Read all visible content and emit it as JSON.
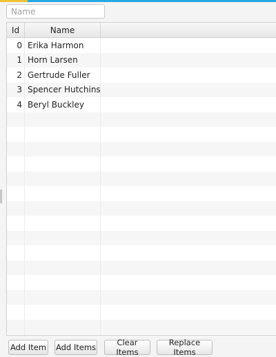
{
  "search": {
    "placeholder": "Name",
    "value": ""
  },
  "table": {
    "columns": [
      {
        "label": "Id"
      },
      {
        "label": "Name"
      }
    ],
    "rows": [
      {
        "id": "0",
        "name": "Erika Harmon"
      },
      {
        "id": "1",
        "name": "Horn Larsen"
      },
      {
        "id": "2",
        "name": "Gertrude Fuller"
      },
      {
        "id": "3",
        "name": "Spencer Hutchinson"
      },
      {
        "id": "4",
        "name": "Beryl Buckley"
      }
    ]
  },
  "toolbar": {
    "add_item_label": "Add Item",
    "add_items_label": "Add Items",
    "clear_items_label": "Clear Items",
    "replace_items_label": "Replace Items"
  },
  "colors": {
    "accent": "#27a9e1",
    "accent_secondary": "#f1c232",
    "row_alt": "#f6f6f6"
  }
}
